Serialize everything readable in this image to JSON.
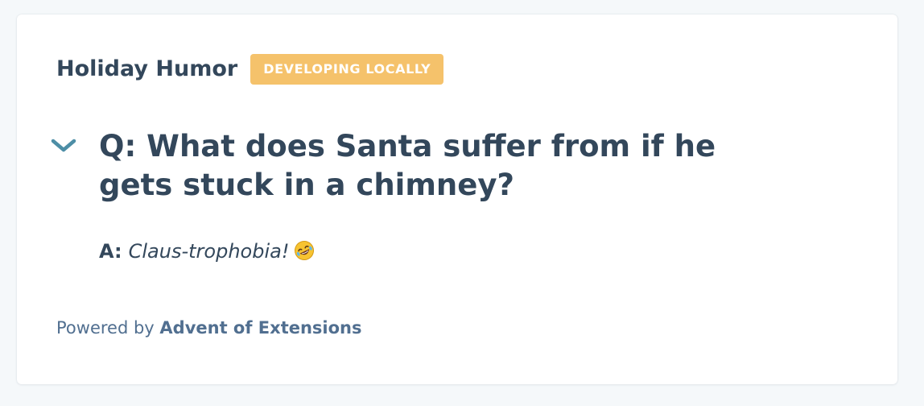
{
  "card": {
    "title": "Holiday Humor",
    "badge": "DEVELOPING LOCALLY"
  },
  "faq": {
    "toggle_icon": "chevron-down-icon",
    "question": "Q: What does Santa suffer from if he gets stuck in a chimney?",
    "answer_label": "A:",
    "answer_text": "Claus-trophobia!",
    "answer_emoji": "rolling-on-the-floor-laughing-emoji"
  },
  "footer": {
    "prefix": "Powered by",
    "link": "Advent of Extensions"
  },
  "colors": {
    "page_background": "#f5f8fa",
    "card_background": "#ffffff",
    "text_primary": "#33475b",
    "text_secondary": "#516f90",
    "badge_background": "#f5c26b",
    "toggle_icon": "#4d8ea6"
  }
}
